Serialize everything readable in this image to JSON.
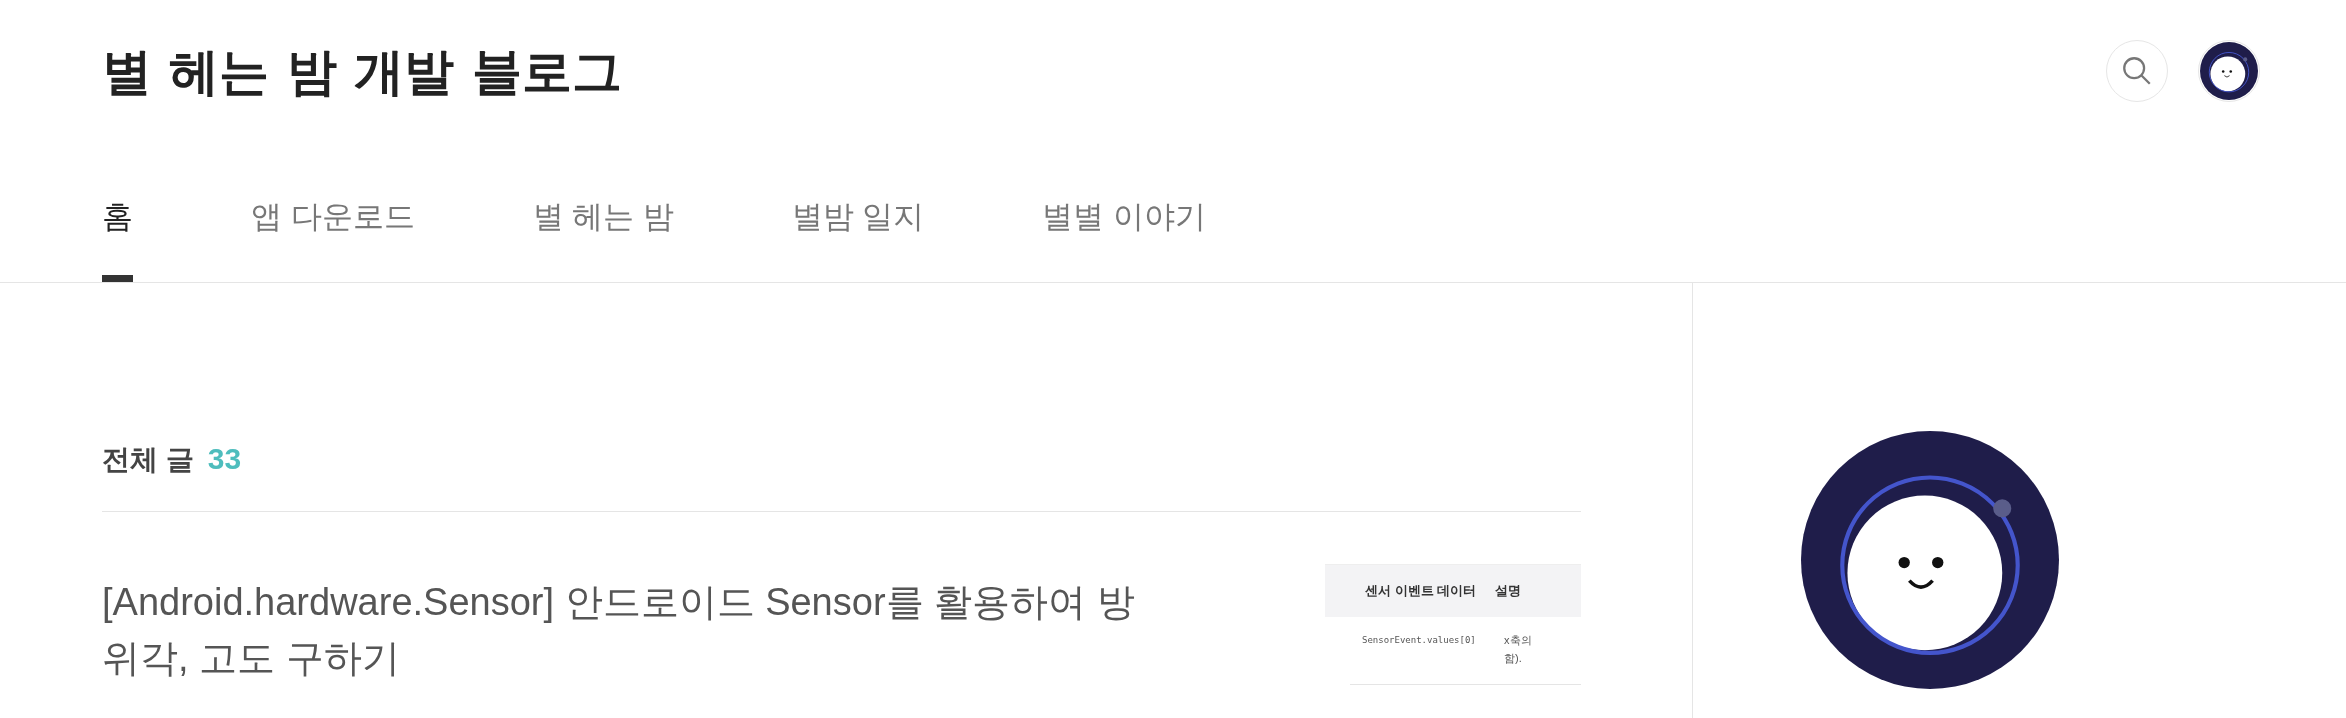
{
  "blog_title": "별 헤는 밤 개발 블로그",
  "tabs": [
    {
      "label": "홈",
      "selected": true
    },
    {
      "label": "앱 다운로드",
      "selected": false
    },
    {
      "label": "별 헤는 밤",
      "selected": false
    },
    {
      "label": "별밤 일지",
      "selected": false
    },
    {
      "label": "별별 이야기",
      "selected": false
    }
  ],
  "post_list": {
    "heading": "전체 글",
    "count": "33",
    "posts": [
      {
        "title": "[Android.hardware.Sensor] 안드로이드 Sensor를 활용하여 방위각, 고도 구하기",
        "thumbnail": {
          "columns": [
            "센서 이벤트 데이터",
            "설명"
          ],
          "rows": [
            [
              "SensorEvent.values[0]",
              "x축의 함)."
            ]
          ]
        }
      }
    ]
  }
}
